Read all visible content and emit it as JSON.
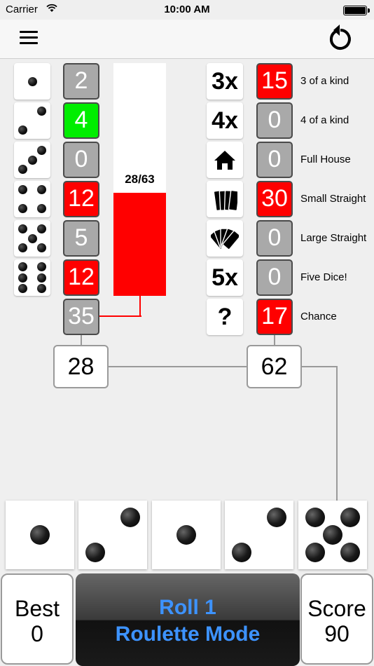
{
  "status_bar": {
    "carrier": "Carrier",
    "time": "10:00 AM"
  },
  "icons": {
    "menu": "hamburger-menu-icon",
    "undo": "undo-arrow-icon"
  },
  "upper": {
    "rows": [
      {
        "face": 1,
        "score": "2",
        "state": "gray"
      },
      {
        "face": 2,
        "score": "4",
        "state": "green"
      },
      {
        "face": 3,
        "score": "0",
        "state": "gray"
      },
      {
        "face": 4,
        "score": "12",
        "state": "red"
      },
      {
        "face": 5,
        "score": "5",
        "state": "gray"
      },
      {
        "face": 6,
        "score": "12",
        "state": "red"
      }
    ],
    "bonus": "35",
    "progress_label": "28/63",
    "progress_fraction": 0.444,
    "total": "28"
  },
  "lower": {
    "rows": [
      {
        "icon": "3x",
        "icon_name": "three-of-a-kind-icon",
        "score": "15",
        "state": "red",
        "label": "3 of a kind"
      },
      {
        "icon": "4x",
        "icon_name": "four-of-a-kind-icon",
        "score": "0",
        "state": "gray",
        "label": "4 of a kind"
      },
      {
        "icon": "",
        "icon_name": "house-icon",
        "score": "0",
        "state": "gray",
        "label": "Full House"
      },
      {
        "icon": "",
        "icon_name": "four-cards-icon",
        "score": "30",
        "state": "red",
        "label": "Small Straight"
      },
      {
        "icon": "",
        "icon_name": "five-cards-icon",
        "score": "0",
        "state": "gray",
        "label": "Large Straight"
      },
      {
        "icon": "5x",
        "icon_name": "five-of-a-kind-icon",
        "score": "0",
        "state": "gray",
        "label": "Five Dice!"
      },
      {
        "icon": "?",
        "icon_name": "chance-icon",
        "score": "17",
        "state": "red",
        "label": "Chance"
      }
    ],
    "total": "62"
  },
  "dice": [
    1,
    2,
    1,
    2,
    5
  ],
  "best": {
    "label": "Best",
    "value": "0"
  },
  "roll": {
    "line1": "Roll 1",
    "line2": "Roulette Mode"
  },
  "score": {
    "label": "Score",
    "value": "90"
  },
  "colors": {
    "red": "#ff0000",
    "green": "#00ee00",
    "gray": "#a9a9a9",
    "button_text": "#3d93ff"
  }
}
